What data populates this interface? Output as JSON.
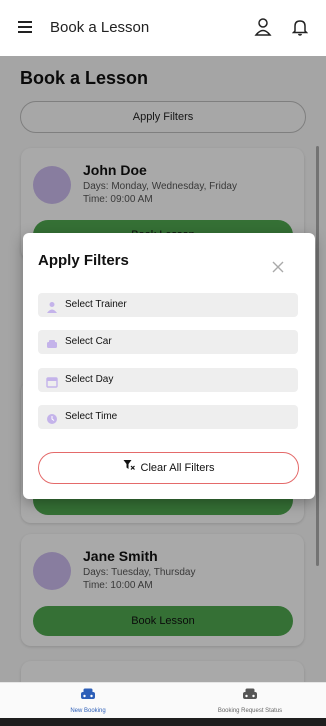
{
  "appbar": {
    "title": "Book a Lesson",
    "icons": [
      "menu-icon",
      "user-icon",
      "bell-icon"
    ]
  },
  "page": {
    "heading": "Book a Lesson",
    "filter_button": "Apply Filters"
  },
  "lessons": [
    {
      "name": "John Doe",
      "days": "Days: Monday, Wednesday, Friday",
      "time": "Time: 09:00 AM",
      "button": "Book Lesson"
    },
    {
      "name": "Jane Smith",
      "days": "Days: Tuesday, Thursday",
      "time": "Time: 10:00 AM",
      "button": "Book Lesson"
    }
  ],
  "dialog": {
    "title": "Apply Filters",
    "options": [
      {
        "label": "Select Trainer",
        "icon": "person-icon"
      },
      {
        "label": "Select Car",
        "icon": "car-icon"
      },
      {
        "label": "Select Day",
        "icon": "calendar-icon"
      },
      {
        "label": "Select Time",
        "icon": "clock-icon"
      }
    ],
    "clear_button": "Clear All Filters"
  },
  "bottom_nav": {
    "items": [
      {
        "label": "New Booking",
        "icon": "car-icon",
        "active": true
      },
      {
        "label": "Booking Request Status",
        "icon": "car-icon",
        "active": false
      }
    ]
  },
  "colors": {
    "accent": "#4ea64f",
    "avatar": "#c9b8ea",
    "active_nav": "#2d5fb8",
    "clear_border": "#e46a6a"
  }
}
